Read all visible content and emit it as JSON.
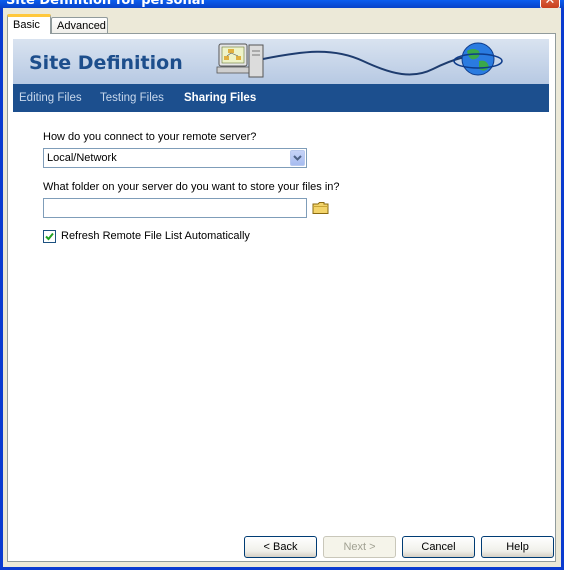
{
  "window": {
    "title": "Site Definition for personal",
    "close_glyph": "✕"
  },
  "tabs": [
    {
      "label": "Basic"
    },
    {
      "label": "Advanced"
    }
  ],
  "banner": {
    "title": "Site Definition"
  },
  "steps": [
    {
      "label": "Editing Files"
    },
    {
      "label": "Testing Files"
    },
    {
      "label": "Sharing Files"
    }
  ],
  "form": {
    "connect_question": "How do you connect to your remote server?",
    "connect_value": "Local/Network",
    "folder_question": "What folder on your server do you want to store your files in?",
    "folder_value": "",
    "refresh_label": "Refresh Remote File List Automatically",
    "refresh_checked": true
  },
  "buttons": {
    "back": "< Back",
    "next": "Next >",
    "cancel": "Cancel",
    "help": "Help"
  },
  "colors": {
    "banner_title": "#1d4e8c",
    "nav_bar": "#1c4f8e",
    "active_tab_accent": "#ffc83c"
  }
}
